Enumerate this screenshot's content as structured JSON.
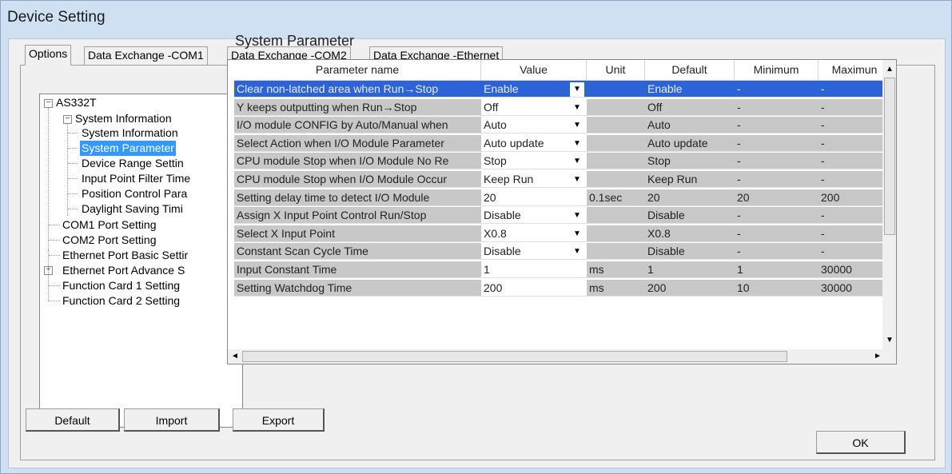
{
  "window": {
    "title": "Device Setting"
  },
  "tabs": [
    {
      "label": "Options"
    },
    {
      "label": "Data Exchange -COM1"
    },
    {
      "label": "Data Exchange -COM2"
    },
    {
      "label": "Data Exchange -Ethernet"
    }
  ],
  "tree": {
    "root": "AS332T",
    "system_information": "System Information",
    "children": [
      "System Information",
      "System Parameter",
      "Device Range Settin",
      "Input Point Filter Time",
      "Position Control Para",
      "Daylight Saving Timi"
    ],
    "items": [
      "COM1 Port Setting",
      "COM2 Port Setting",
      "Ethernet Port Basic Settir",
      "Ethernet Port Advance S",
      "Function Card 1 Setting",
      "Function Card 2 Setting"
    ],
    "selected": "System Parameter"
  },
  "section_title": "System Parameter",
  "table": {
    "headers": [
      "Parameter name",
      "Value",
      "Unit",
      "Default",
      "Minimum",
      "Maximun"
    ],
    "rows": [
      {
        "name": "Clear non-latched area when Run→Stop",
        "value": "Enable",
        "dropdown": true,
        "unit": "",
        "default": "Enable",
        "min": "-",
        "max": "-"
      },
      {
        "name": "Y keeps outputting when Run→Stop",
        "value": "Off",
        "dropdown": true,
        "unit": "",
        "default": "Off",
        "min": "-",
        "max": "-"
      },
      {
        "name": "I/O module CONFIG by Auto/Manual when",
        "value": "Auto",
        "dropdown": true,
        "unit": "",
        "default": "Auto",
        "min": "-",
        "max": "-"
      },
      {
        "name": "Select Action when I/O Module Parameter",
        "value": "Auto update",
        "dropdown": true,
        "unit": "",
        "default": "Auto update",
        "min": "-",
        "max": "-"
      },
      {
        "name": "CPU module Stop when I/O Module No Re",
        "value": "Stop",
        "dropdown": true,
        "unit": "",
        "default": "Stop",
        "min": "-",
        "max": "-"
      },
      {
        "name": "CPU module Stop when I/O Module Occur",
        "value": "Keep Run",
        "dropdown": true,
        "unit": "",
        "default": "Keep Run",
        "min": "-",
        "max": "-"
      },
      {
        "name": "Setting delay time to detect I/O Module",
        "value": "20",
        "dropdown": false,
        "unit": "0.1sec",
        "default": "20",
        "min": "20",
        "max": "200"
      },
      {
        "name": "Assign X Input Point Control Run/Stop",
        "value": "Disable",
        "dropdown": true,
        "unit": "",
        "default": "Disable",
        "min": "-",
        "max": "-"
      },
      {
        "name": "Select X Input Point",
        "value": "X0.8",
        "dropdown": true,
        "unit": "",
        "default": "X0.8",
        "min": "-",
        "max": "-"
      },
      {
        "name": "Constant Scan Cycle Time",
        "value": "Disable",
        "dropdown": true,
        "unit": "",
        "default": "Disable",
        "min": "-",
        "max": "-"
      },
      {
        "name": "Input Constant Time",
        "value": "1",
        "dropdown": false,
        "unit": "ms",
        "default": "1",
        "min": "1",
        "max": "30000"
      },
      {
        "name": "Setting Watchdog Time",
        "value": "200",
        "dropdown": false,
        "unit": "ms",
        "default": "200",
        "min": "10",
        "max": "30000"
      }
    ]
  },
  "buttons": {
    "default": "Default",
    "import": "Import",
    "export": "Export",
    "ok": "OK"
  },
  "icons": {
    "dropdown": "chevron-down-icon",
    "expander_open": "−",
    "expander_closed": "+",
    "scroll_up": "▲",
    "scroll_down": "▼",
    "scroll_left": "◄",
    "scroll_right": "►"
  },
  "colors": {
    "selection": "#2c63d6",
    "tree_selection": "#3399ff",
    "readonly_cell": "#c8c8c8"
  }
}
